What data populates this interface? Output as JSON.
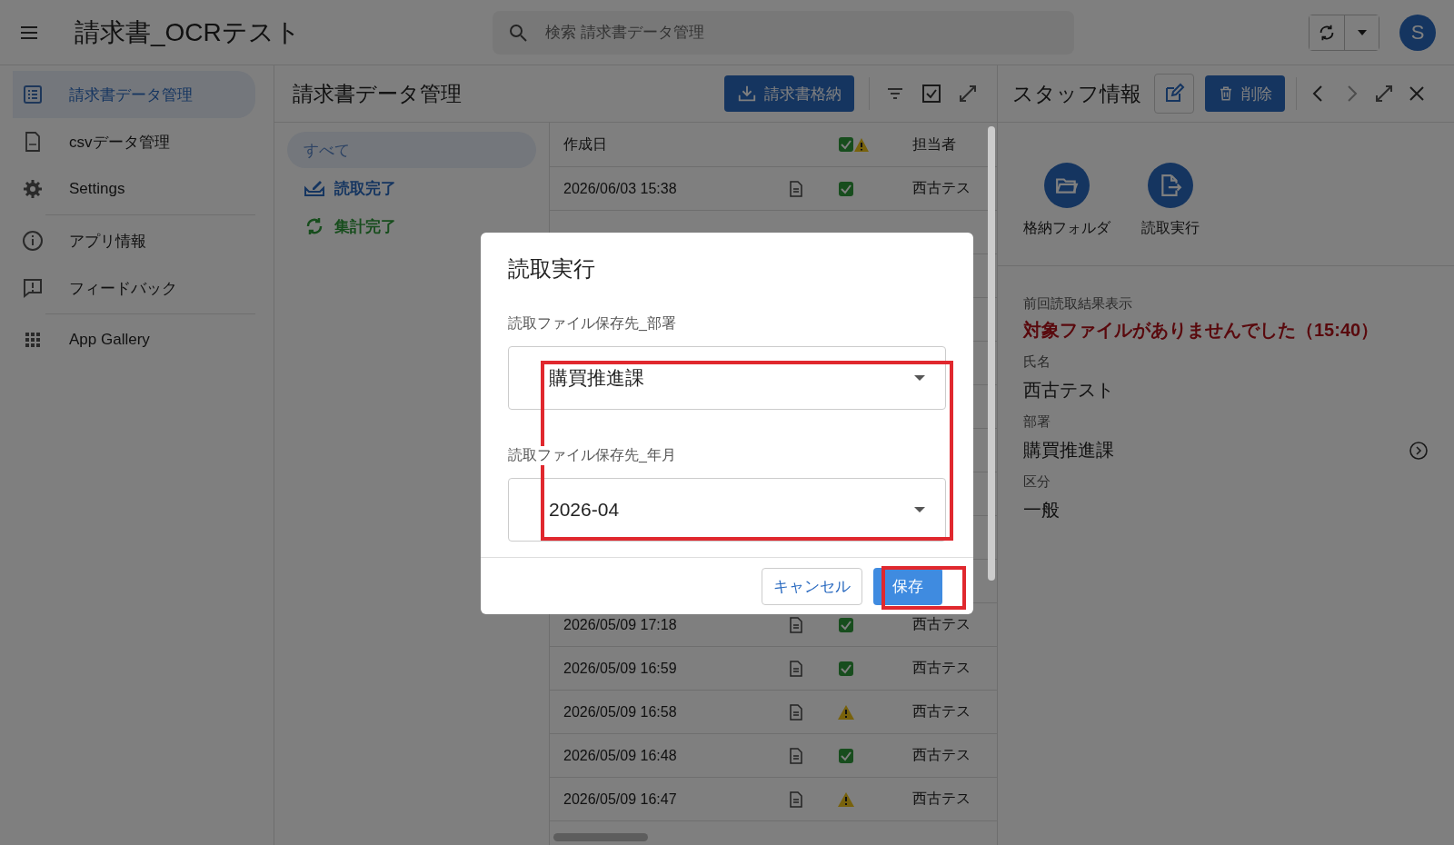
{
  "app_bar": {
    "title": "請求書_OCRテスト",
    "search": {
      "placeholder": "検索 請求書データ管理"
    },
    "avatar": "S"
  },
  "sidebar": {
    "groups": [
      [
        {
          "label": "請求書データ管理",
          "selected": true
        },
        {
          "label": "csvデータ管理",
          "selected": false
        },
        {
          "label": "Settings",
          "selected": false
        }
      ],
      [
        {
          "label": "アプリ情報",
          "selected": false
        },
        {
          "label": "フィードバック",
          "selected": false
        }
      ],
      [
        {
          "label": "App Gallery",
          "selected": false
        }
      ]
    ]
  },
  "list_view": {
    "title": "請求書データ管理",
    "action_button": "請求書格納",
    "filters": [
      {
        "label": "すべて",
        "kind": "plain",
        "selected": true
      },
      {
        "label": "読取完了",
        "kind": "read",
        "selected": false
      },
      {
        "label": "集計完了",
        "kind": "aggregated",
        "selected": false
      }
    ],
    "table": {
      "columns": {
        "date": "作成日",
        "assignee": "担当者"
      },
      "top_rows": [
        {
          "date": "2026/06/03 15:38",
          "kind": "ok",
          "assignee": "西古テス"
        }
      ],
      "bottom_rows": [
        {
          "date": "2026/05/09 17:18",
          "kind": "ok",
          "assignee": "西古テス"
        },
        {
          "date": "2026/05/09 16:59",
          "kind": "ok",
          "assignee": "西古テス"
        },
        {
          "date": "2026/05/09 16:58",
          "kind": "warning",
          "assignee": "西古テス"
        },
        {
          "date": "2026/05/09 16:48",
          "kind": "ok",
          "assignee": "西古テス"
        },
        {
          "date": "2026/05/09 16:47",
          "kind": "warning",
          "assignee": "西古テス"
        }
      ]
    }
  },
  "detail": {
    "title": "スタッフ情報",
    "delete_button": "削除",
    "actions": [
      {
        "label": "格納フォルダ"
      },
      {
        "label": "読取実行"
      }
    ],
    "result_label": "前回読取結果表示",
    "result_text": "対象ファイルがありませんでした（15:40）",
    "fields": [
      {
        "label": "氏名",
        "value": "西古テスト",
        "link": false
      },
      {
        "label": "部署",
        "value": "購買推進課",
        "link": true
      },
      {
        "label": "区分",
        "value": "一般",
        "link": false
      }
    ]
  },
  "dialog": {
    "title": "読取実行",
    "fields": [
      {
        "label": "読取ファイル保存先_部署",
        "value": "購買推進課"
      },
      {
        "label": "読取ファイル保存先_年月",
        "value": "2026-04"
      }
    ],
    "cancel_button": "キャンセル",
    "save_button": "保存",
    "highlight_fields": true,
    "highlight_save": true
  }
}
